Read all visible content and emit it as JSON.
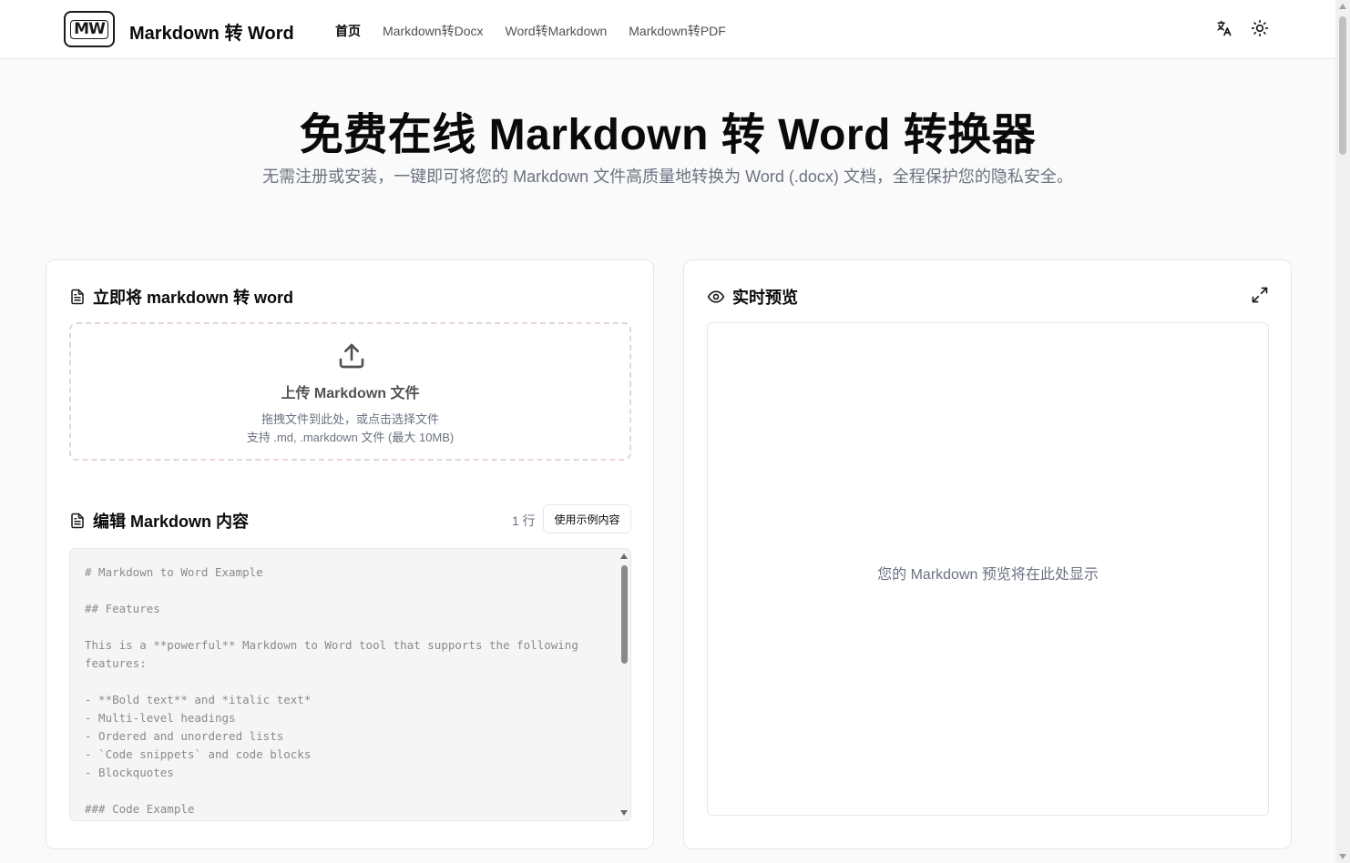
{
  "header": {
    "logo_text": "MW",
    "brand": "Markdown 转 Word",
    "nav": [
      {
        "label": "首页",
        "active": true
      },
      {
        "label": "Markdown转Docx",
        "active": false
      },
      {
        "label": "Word转Markdown",
        "active": false
      },
      {
        "label": "Markdown转PDF",
        "active": false
      }
    ],
    "icons": [
      "translate-icon",
      "sun-icon"
    ]
  },
  "hero": {
    "title": "免费在线 Markdown 转 Word 转换器",
    "subtitle": "无需注册或安装，一键即可将您的 Markdown 文件高质量地转换为 Word (.docx) 文档，全程保护您的隐私安全。"
  },
  "left": {
    "title": "立即将 markdown 转 word",
    "upload": {
      "title": "上传 Markdown 文件",
      "hint": "拖拽文件到此处，或点击选择文件",
      "formats": "支持 .md, .markdown 文件 (最大 10MB)"
    },
    "editor": {
      "title": "编辑 Markdown 内容",
      "line_count": "1 行",
      "sample_button": "使用示例内容",
      "placeholder": "# Markdown to Word Example\n\n## Features\n\nThis is a **powerful** Markdown to Word tool that supports the following features:\n\n- **Bold text** and *italic text*\n- Multi-level headings\n- Ordered and unordered lists\n- `Code snippets` and code blocks\n- Blockquotes\n\n### Code Example"
    }
  },
  "right": {
    "title": "实时预览",
    "placeholder": "您的 Markdown 预览将在此处显示"
  },
  "colors": {
    "text": "#0a0a0a",
    "muted": "#6b7280",
    "border": "#e5e7eb",
    "background": "#fafafa"
  }
}
